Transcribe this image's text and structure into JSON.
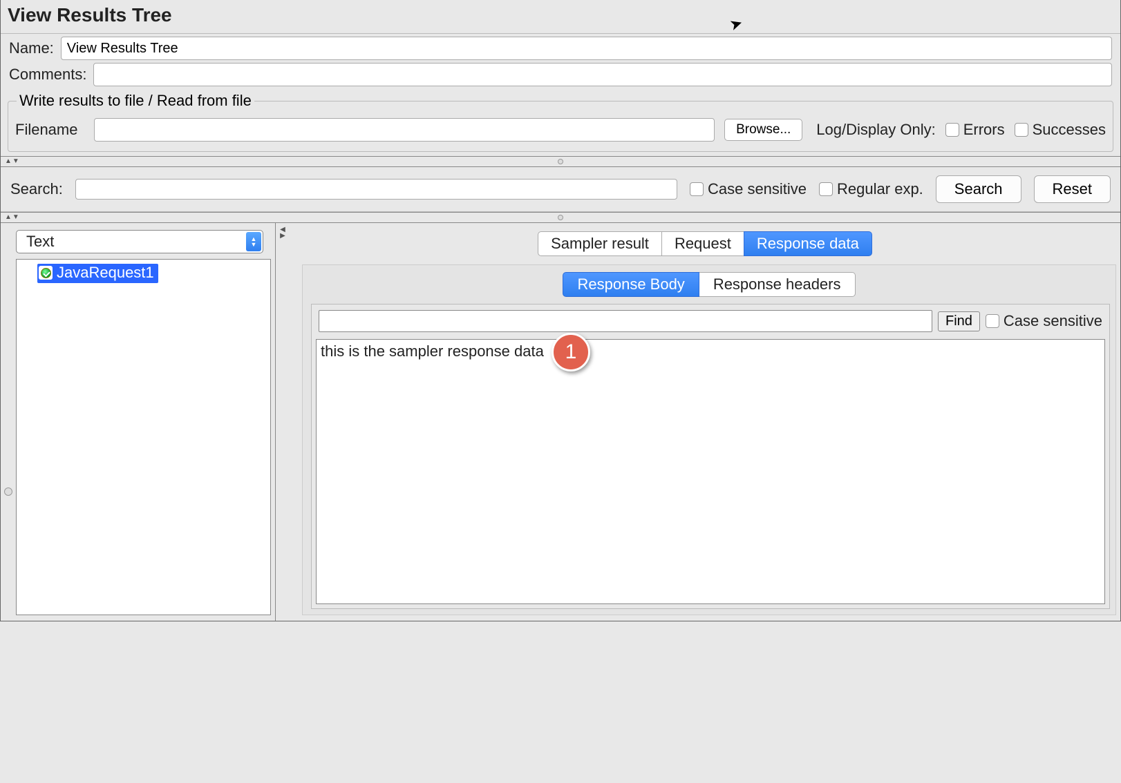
{
  "header": {
    "title": "View Results Tree"
  },
  "form": {
    "name_label": "Name:",
    "name_value": "View Results Tree",
    "comments_label": "Comments:",
    "comments_value": ""
  },
  "file_group": {
    "legend": "Write results to file / Read from file",
    "filename_label": "Filename",
    "filename_value": "",
    "browse_label": "Browse...",
    "logdisplay_label": "Log/Display Only:",
    "errors_label": "Errors",
    "successes_label": "Successes"
  },
  "search": {
    "label": "Search:",
    "value": "",
    "case_label": "Case sensitive",
    "regex_label": "Regular exp.",
    "search_btn": "Search",
    "reset_btn": "Reset"
  },
  "left": {
    "renderer": "Text",
    "nodes": [
      {
        "name": "JavaRequest1",
        "status": "pass"
      }
    ]
  },
  "tabs": {
    "sampler": "Sampler result",
    "request": "Request",
    "response": "Response data",
    "active": "response"
  },
  "subtabs": {
    "body": "Response Body",
    "headers": "Response headers",
    "active": "body"
  },
  "find": {
    "value": "",
    "button": "Find",
    "case_label": "Case sensitive"
  },
  "response_text": "this is the sampler response data",
  "annotation": {
    "text": "1"
  }
}
